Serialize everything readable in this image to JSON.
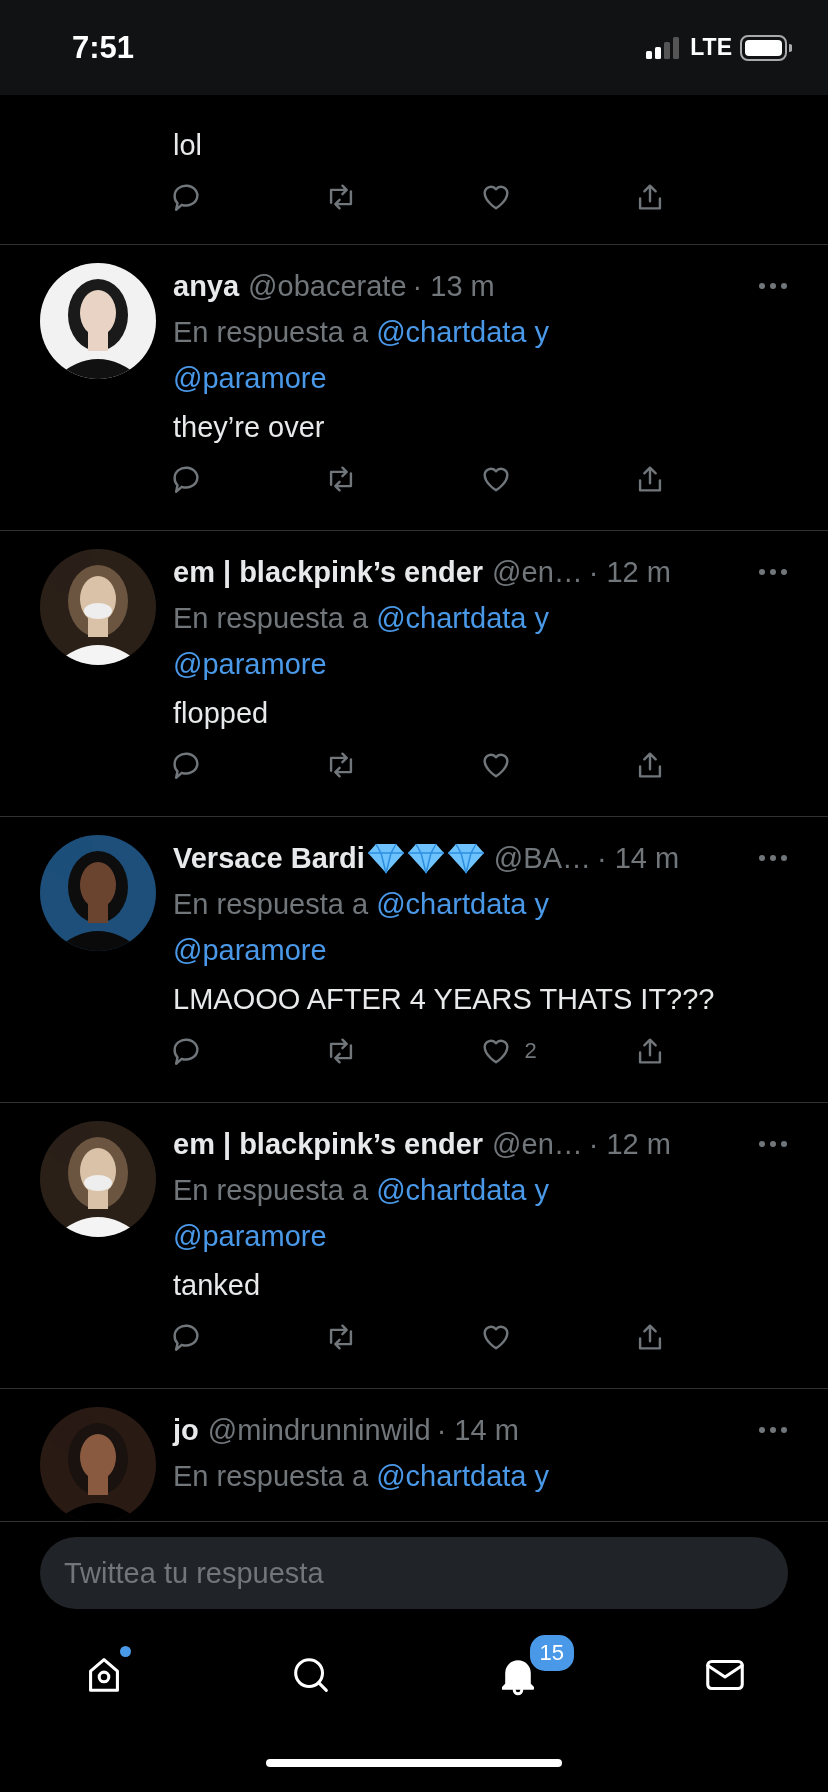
{
  "status_bar": {
    "time": "7:51",
    "network": "LTE"
  },
  "tweets": [
    {
      "kind": "tail",
      "text": "lol"
    },
    {
      "kind": "full",
      "name": "anya",
      "handle": "@obacerate",
      "time": "· 13 m",
      "reply_label": "En respuesta a",
      "mentions": [
        "@chartdata y",
        "@paramore"
      ],
      "text": "they’re over"
    },
    {
      "kind": "full",
      "name": "em | blackpink’s ender",
      "handle": "@en…",
      "time": "· 12 m",
      "reply_label": "En respuesta a",
      "mentions": [
        "@chartdata y",
        "@paramore"
      ],
      "text": "flopped"
    },
    {
      "kind": "full",
      "name": "Versace Bardi",
      "badges": [
        {
          "kind": "diamond"
        },
        {
          "kind": "diamond"
        },
        {
          "kind": "diamond"
        }
      ],
      "handle": "@BA…",
      "time": "· 14 m",
      "reply_label": "En respuesta a",
      "mentions": [
        "@chartdata y",
        "@paramore"
      ],
      "text": "LMAOOO AFTER 4 YEARS THATS IT???",
      "likes": "2"
    },
    {
      "kind": "full",
      "name": "em | blackpink’s ender",
      "handle": "@en…",
      "time": "· 12 m",
      "reply_label": "En respuesta a",
      "mentions": [
        "@chartdata y",
        "@paramore"
      ],
      "text": "tanked"
    },
    {
      "kind": "head",
      "name": "jo",
      "handle": "@mindrunninwild",
      "time": "· 14 m",
      "reply_label": "En respuesta a",
      "mentions": [
        "@chartdata y"
      ]
    }
  ],
  "composer": {
    "placeholder": "Twittea tu respuesta"
  },
  "tabs": [
    {
      "kind": "home",
      "has_new": true
    },
    {
      "kind": "search",
      "has_new": false
    },
    {
      "kind": "notifications",
      "has_new": false,
      "badge": "15"
    },
    {
      "kind": "messages",
      "has_new": false
    }
  ]
}
